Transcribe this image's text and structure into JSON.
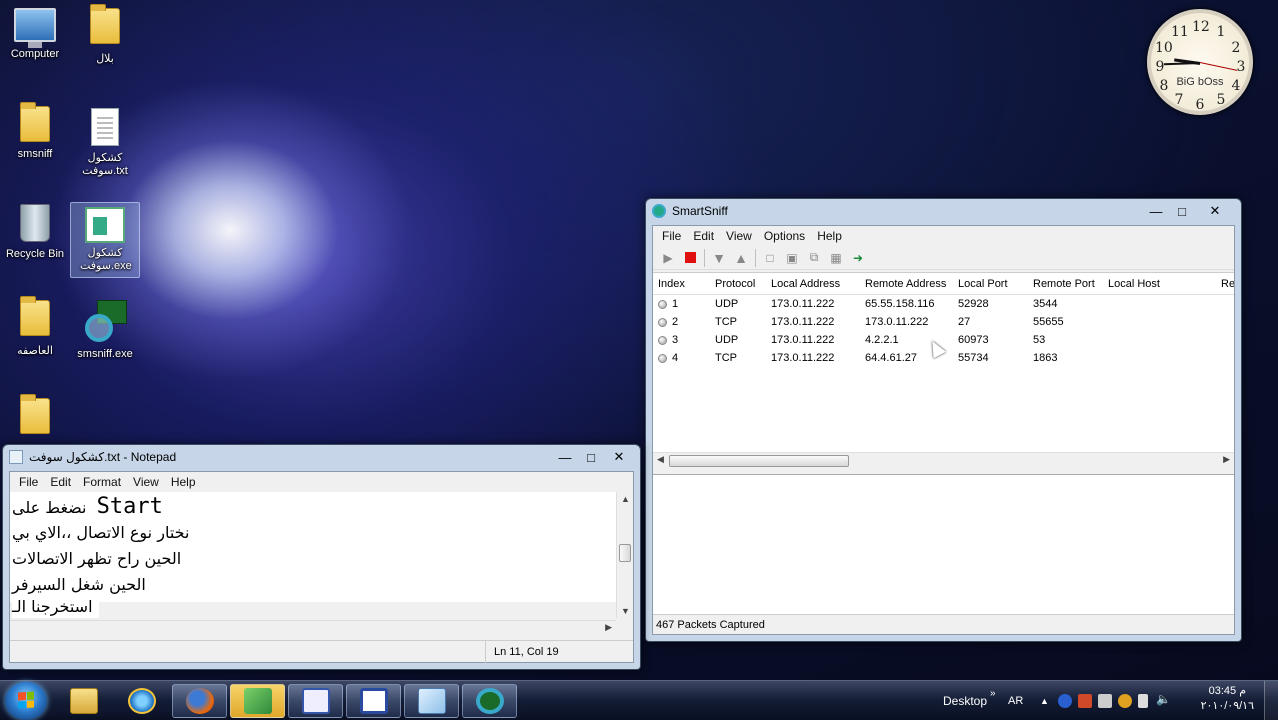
{
  "desktop": {
    "icons": [
      {
        "label": "Computer"
      },
      {
        "label": "بلال"
      },
      {
        "label": "smsniff"
      },
      {
        "label": "كشكول سوفت.txt"
      },
      {
        "label": "Recycle Bin"
      },
      {
        "label": "كشكول سوفت.exe"
      },
      {
        "label": "العاصفه"
      },
      {
        "label": "smsniff.exe"
      }
    ]
  },
  "clock_gadget": {
    "brand": "BiG bOss",
    "numbers": [
      "12",
      "1",
      "2",
      "3",
      "4",
      "5",
      "6",
      "7",
      "8",
      "9",
      "10",
      "11"
    ]
  },
  "smartsniff": {
    "title": "SmartSniff",
    "menu": [
      "File",
      "Edit",
      "View",
      "Options",
      "Help"
    ],
    "toolbar_icons": [
      "play-icon",
      "stop-icon",
      "filter-down-icon",
      "filter-up-icon",
      "new-icon",
      "save-icon",
      "copy-icon",
      "properties-icon",
      "exit-icon"
    ],
    "columns": [
      "Index",
      "Protocol",
      "Local Address",
      "Remote Address",
      "Local Port",
      "Remote Port",
      "Local Host",
      "Re"
    ],
    "rows": [
      {
        "index": "1",
        "protocol": "UDP",
        "local_address": "173.0.11.222",
        "remote_address": "65.55.158.116",
        "local_port": "52928",
        "remote_port": "3544",
        "local_host": ""
      },
      {
        "index": "2",
        "protocol": "TCP",
        "local_address": "173.0.11.222",
        "remote_address": "173.0.11.222",
        "local_port": "27",
        "remote_port": "55655",
        "local_host": ""
      },
      {
        "index": "3",
        "protocol": "UDP",
        "local_address": "173.0.11.222",
        "remote_address": "4.2.2.1",
        "local_port": "60973",
        "remote_port": "53",
        "local_host": ""
      },
      {
        "index": "4",
        "protocol": "TCP",
        "local_address": "173.0.11.222",
        "remote_address": "64.4.61.27",
        "local_port": "55734",
        "remote_port": "1863",
        "local_host": ""
      }
    ],
    "status": "467 Packets Captured"
  },
  "notepad": {
    "title": "كشكول سوفت.txt - Notepad",
    "menu": [
      "File",
      "Edit",
      "Format",
      "View",
      "Help"
    ],
    "lines": [
      {
        "text": "نضغط على",
        "mono": "Start"
      },
      {
        "text": "نختار نوع الاتصال ،،الاي بي",
        "mono": ""
      },
      {
        "text": "الحين راح تظهر الاتصالات",
        "mono": ""
      },
      {
        "text": "الحين شغل السيرفر",
        "mono": ""
      },
      {
        "text": "استخرجنا الـ",
        "mono": ""
      }
    ],
    "status": "Ln 11, Col 19"
  },
  "taskbar": {
    "apps": [
      "explorer-icon",
      "ie-icon",
      "firefox-icon",
      "network-icon",
      "vb-icon",
      "app-icon",
      "notepad-icon",
      "smartsniff-icon"
    ],
    "desktop_label": "Desktop",
    "lang": "AR",
    "time": "03:45 م",
    "date": "٢٠١٠/٠٩/١٦"
  }
}
